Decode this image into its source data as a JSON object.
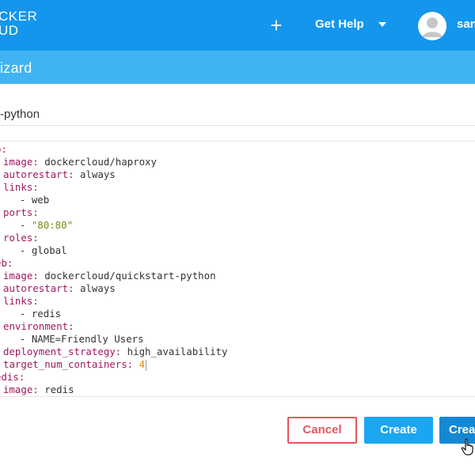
{
  "header": {
    "logo_line1": "CKER",
    "logo_line2": "UD",
    "add_icon": "plus-icon",
    "help_label": "Get Help",
    "username": "san"
  },
  "subheader": {
    "title": "izard"
  },
  "stack_name": "-python",
  "editor": {
    "lines": [
      [
        {
          "t": "p:",
          "c": "key"
        }
      ],
      [
        {
          "t": "image:",
          "c": "key"
        },
        {
          "t": " dockercloud/haproxy"
        }
      ],
      [
        {
          "t": "autorestart:",
          "c": "key"
        },
        {
          "t": " always"
        }
      ],
      [
        {
          "t": "links:",
          "c": "key"
        }
      ],
      [
        {
          "t": "  - web"
        }
      ],
      [
        {
          "t": "ports:",
          "c": "key"
        }
      ],
      [
        {
          "t": "  - "
        },
        {
          "t": "\"80:80\"",
          "c": "str"
        }
      ],
      [
        {
          "t": "roles:",
          "c": "key"
        }
      ],
      [
        {
          "t": "  - global"
        }
      ],
      [
        {
          "t": "eb:",
          "c": "key"
        }
      ],
      [
        {
          "t": "image:",
          "c": "key"
        },
        {
          "t": " dockercloud/quickstart-python"
        }
      ],
      [
        {
          "t": "autorestart:",
          "c": "key"
        },
        {
          "t": " always"
        }
      ],
      [
        {
          "t": "links:",
          "c": "key"
        }
      ],
      [
        {
          "t": "  - redis"
        }
      ],
      [
        {
          "t": "environment:",
          "c": "key"
        }
      ],
      [
        {
          "t": "  - NAME=Friendly Users"
        }
      ],
      [
        {
          "t": "deployment_strategy:",
          "c": "key"
        },
        {
          "t": " high_availability"
        }
      ],
      [
        {
          "t": "target_num_containers:",
          "c": "key"
        },
        {
          "t": " "
        },
        {
          "t": "4",
          "c": "num"
        },
        {
          "t": "",
          "cursor": true
        }
      ],
      [
        {
          "t": "edis:",
          "c": "key"
        }
      ],
      [
        {
          "t": "image:",
          "c": "key"
        },
        {
          "t": " redis"
        }
      ]
    ]
  },
  "buttons": {
    "cancel": "Cancel",
    "create": "Create",
    "create_deploy": "Crea"
  },
  "colors": {
    "topbar": "#1396ec",
    "subbar": "#40b3f2",
    "cancel": "#e5575d",
    "create": "#1aa6f0",
    "create_deploy": "#1588d4"
  }
}
